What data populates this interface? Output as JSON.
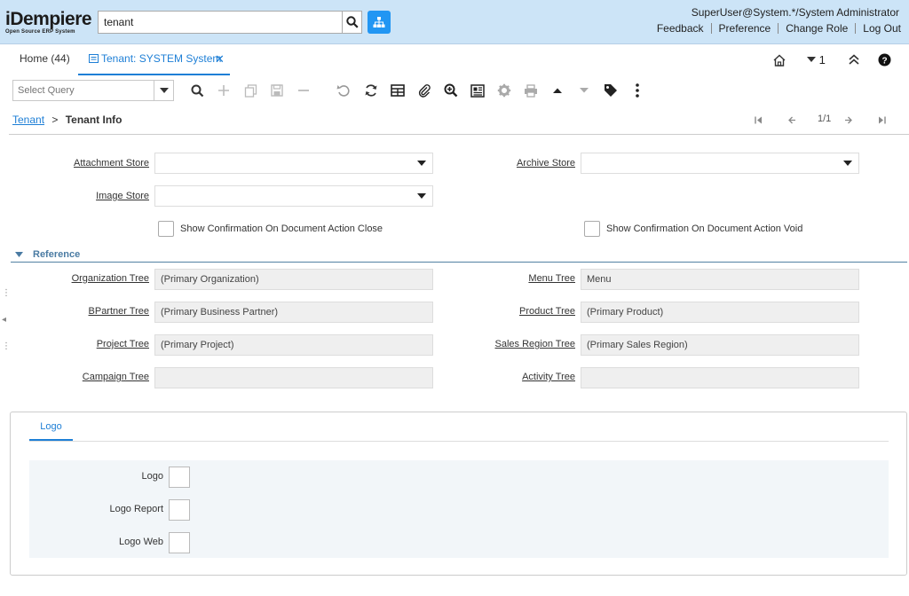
{
  "header": {
    "logo_main": "iDempiere",
    "logo_sub": "Open Source ERP System",
    "search_value": "tenant",
    "user": "SuperUser@System.*/System Administrator",
    "links": [
      "Feedback",
      "Preference",
      "Change Role",
      "Log Out"
    ]
  },
  "tabs": {
    "home": "Home (44)",
    "active": "Tenant: SYSTEM System",
    "count": "1"
  },
  "toolbar": {
    "query_placeholder": "Select Query"
  },
  "breadcrumb": {
    "parent": "Tenant",
    "separator": ">",
    "current": "Tenant Info",
    "record": "1/1"
  },
  "form": {
    "attachment_store": "Attachment Store",
    "archive_store": "Archive Store",
    "image_store": "Image Store",
    "chk_close": "Show Confirmation On Document Action Close",
    "chk_void": "Show Confirmation On Document Action Void",
    "section_reference": "Reference",
    "org_tree_label": "Organization Tree",
    "org_tree_value": "(Primary Organization)",
    "menu_tree_label": "Menu Tree",
    "menu_tree_value": "Menu",
    "bp_tree_label": "BPartner Tree",
    "bp_tree_value": "(Primary Business Partner)",
    "product_tree_label": "Product Tree",
    "product_tree_value": "(Primary Product)",
    "project_tree_label": "Project Tree",
    "project_tree_value": "(Primary Project)",
    "sales_region_label": "Sales Region Tree",
    "sales_region_value": "(Primary Sales Region)",
    "campaign_tree_label": "Campaign Tree",
    "campaign_tree_value": "",
    "activity_tree_label": "Activity Tree",
    "activity_tree_value": ""
  },
  "logo_panel": {
    "tab": "Logo",
    "logo": "Logo",
    "logo_report": "Logo Report",
    "logo_web": "Logo Web"
  },
  "colors": {
    "header_bg": "#cce4f7",
    "accent": "#1e7fd6",
    "sitemap_btn": "#2196f3"
  }
}
